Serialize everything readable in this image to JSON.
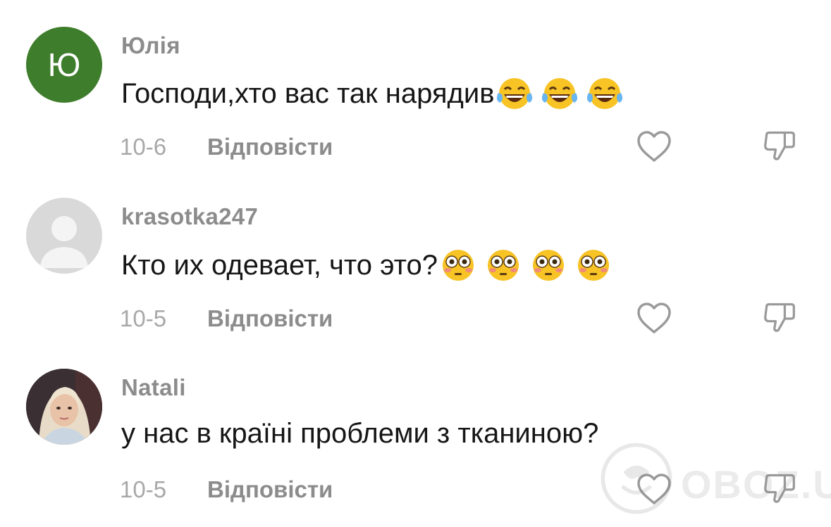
{
  "comments": [
    {
      "avatar_letter": "Ю",
      "username": "Юлія",
      "text": "Господи,хто вас так нарядив",
      "emoji_name": "face-with-tears-of-joy",
      "date": "10-6",
      "reply_label": "Відповісти"
    },
    {
      "username": "krasotka247",
      "text": "Кто их одевает, что это?",
      "emoji_name": "flushed-face",
      "date": "10-5",
      "reply_label": "Відповісти"
    },
    {
      "username": "Natali",
      "text": "у нас в країні проблеми з тканиною?",
      "date": "10-5",
      "reply_label": "Відповісти"
    }
  ],
  "watermark": "OBOZ.UA",
  "colors": {
    "avatar_green": "#3e7d2b",
    "username_gray": "#8c8c8c",
    "date_gray": "#a8a8a8",
    "text_dark": "#161616"
  },
  "icons": {
    "like": "heart-outline-icon",
    "dislike": "thumbs-down-outline-icon"
  }
}
